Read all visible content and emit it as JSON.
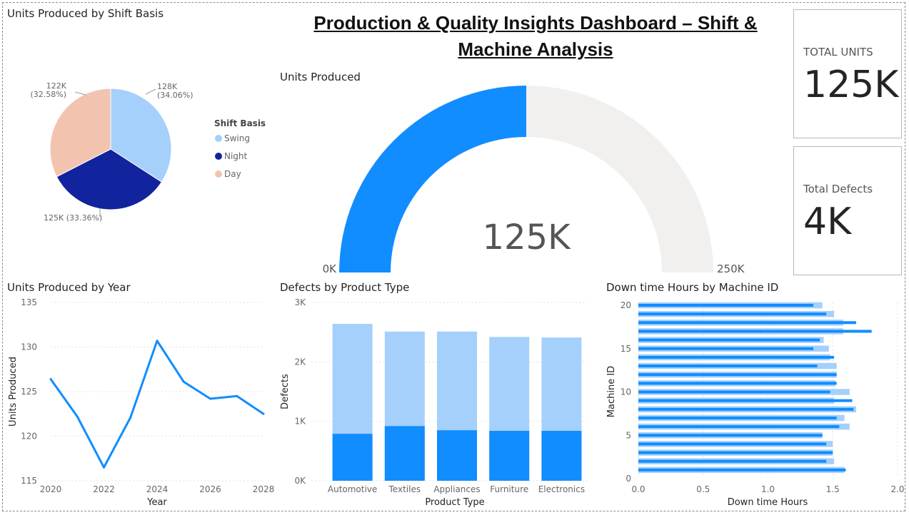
{
  "dashboard": {
    "title": "Production & Quality Insights Dashboard – Shift & Machine Analysis"
  },
  "cards": {
    "total_units": {
      "label": "TOTAL UNITS",
      "value": "125K"
    },
    "total_defects": {
      "label": "Total Defects",
      "value": "4K"
    }
  },
  "visuals": {
    "pie_title": "Units Produced by Shift Basis",
    "gauge_title": "Units Produced",
    "line_title": "Units Produced by Year",
    "bar_title": "Defects by Product Type",
    "hbar_title": "Down time Hours by Machine ID"
  },
  "colors": {
    "swing": "#A5D0FB",
    "night": "#12239E",
    "day": "#F2C4B0",
    "blue": "#118DFF",
    "light_blue": "#A5D0FB",
    "gauge_track": "#F1F0EF",
    "grid": "#E1E1E1"
  },
  "chart_data": [
    {
      "type": "pie",
      "title": "Units Produced by Shift Basis",
      "legend_title": "Shift Basis",
      "legend_position": "right",
      "slices": [
        {
          "name": "Swing",
          "value": 128,
          "label": "128K",
          "pct": "(34.06%)"
        },
        {
          "name": "Night",
          "value": 125,
          "label": "125K (33.36%)",
          "pct": ""
        },
        {
          "name": "Day",
          "value": 122,
          "label": "122K",
          "pct": "(32.58%)"
        }
      ]
    },
    {
      "type": "gauge",
      "title": "Units Produced",
      "value": 125,
      "value_label": "125K",
      "min": 0,
      "min_label": "0K",
      "max": 250,
      "max_label": "250K"
    },
    {
      "type": "line",
      "title": "Units Produced by Year",
      "xlabel": "Year",
      "ylabel": "Units Produced",
      "x": [
        2020,
        2021,
        2022,
        2023,
        2024,
        2025,
        2026,
        2027,
        2028
      ],
      "values": [
        126.4,
        122.2,
        116.5,
        122.1,
        130.7,
        126.1,
        124.2,
        124.5,
        122.5
      ],
      "xticks": [
        "2020",
        "2022",
        "2024",
        "2026",
        "2028"
      ],
      "yticks": [
        "115",
        "120",
        "125",
        "130",
        "135"
      ],
      "xlim": [
        2020,
        2028
      ],
      "ylim": [
        115,
        135
      ],
      "grid": true
    },
    {
      "type": "bar",
      "title": "Defects by Product Type",
      "xlabel": "Product Type",
      "ylabel": "Defects",
      "categories": [
        "Automotive",
        "Textiles",
        "Appliances",
        "Furniture",
        "Electronics"
      ],
      "values": [
        2640,
        2510,
        2510,
        2420,
        2410
      ],
      "inner_values": [
        790,
        920,
        850,
        840,
        840
      ],
      "yticks": [
        "0K",
        "1K",
        "2K",
        "3K"
      ],
      "ylim": [
        0,
        3000
      ],
      "grid": true
    },
    {
      "type": "bar",
      "orientation": "horizontal",
      "title": "Down time Hours by Machine ID",
      "xlabel": "Down time Hours",
      "ylabel": "Machine ID",
      "categories": [
        1,
        2,
        3,
        4,
        5,
        6,
        7,
        8,
        9,
        10,
        11,
        12,
        13,
        14,
        15,
        16,
        17,
        18,
        19,
        20
      ],
      "values": [
        1.59,
        1.51,
        1.5,
        1.5,
        1.42,
        1.63,
        1.59,
        1.68,
        1.51,
        1.63,
        1.52,
        1.53,
        1.53,
        1.48,
        1.47,
        1.43,
        1.58,
        1.58,
        1.51,
        1.42
      ],
      "inner_values": [
        1.6,
        1.45,
        1.5,
        1.45,
        1.42,
        1.55,
        1.53,
        1.66,
        1.65,
        1.48,
        1.53,
        1.53,
        1.38,
        1.51,
        1.35,
        1.4,
        1.8,
        1.68,
        1.45,
        1.35
      ],
      "xticks": [
        "0.0",
        "0.5",
        "1.0",
        "1.5",
        "2.0"
      ],
      "yticks": [
        "0",
        "5",
        "10",
        "15",
        "20"
      ],
      "xlim": [
        0,
        2.0
      ],
      "ylim": [
        0,
        20
      ],
      "grid": true
    }
  ]
}
